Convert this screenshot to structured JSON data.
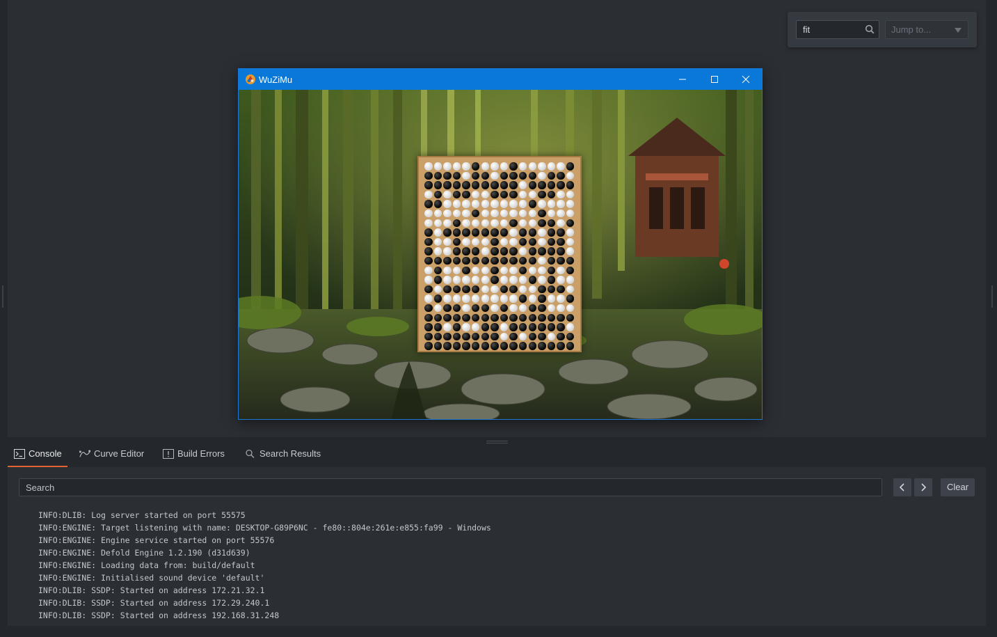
{
  "toolbar": {
    "find_value": "fit",
    "jump_placeholder": "Jump to..."
  },
  "game_window": {
    "title": "WuZiMu"
  },
  "board": {
    "rows": [
      "WWWWWBWWWBWWWWWB",
      "BBBBWBBWBBBBWBBW",
      "BBBBBBBBBBWBBBBB",
      "WBWBBWWBBBWWBBWW",
      "BBWWWWWWWWWBWWWW",
      "WWWWWBWWWWWWBWWW",
      "WWWBWWWWWBWWBBWB",
      "BWBBBBBBBWBBWBBW",
      "BWWBWWWBWWBBWBBW",
      "BWWBBBWBBBWBBBBW",
      "BBBBBBBBBBBBWBBB",
      "WBWWBWWBWWBWWBWB",
      "WBWWWWWBWWWBWBWW",
      "BWBBBBWWBBWWBBBW",
      "WBWWWWWWWWBWBWWB",
      "BWBBWBBWBWWBBWWW",
      "BBBBBBBBBBBBBBBB",
      "BBWBWWBBWBBBBBBW",
      "BBBBBBBBWBWBBWBB",
      "BBBBBBBBBBBBBBBB"
    ]
  },
  "bottom_panel": {
    "tabs": [
      {
        "label": "Console"
      },
      {
        "label": "Curve Editor"
      },
      {
        "label": "Build Errors"
      },
      {
        "label": "Search Results"
      }
    ],
    "search_placeholder": "Search",
    "clear_label": "Clear",
    "log_lines": [
      "INFO:DLIB: Log server started on port 55575",
      "INFO:ENGINE: Target listening with name: DESKTOP-G89P6NC - fe80::804e:261e:e855:fa99 - Windows",
      "INFO:ENGINE: Engine service started on port 55576",
      "INFO:ENGINE: Defold Engine 1.2.190 (d31d639)",
      "INFO:ENGINE: Loading data from: build/default",
      "INFO:ENGINE: Initialised sound device 'default'",
      "INFO:DLIB: SSDP: Started on address 172.21.32.1",
      "INFO:DLIB: SSDP: Started on address 172.29.240.1",
      "INFO:DLIB: SSDP: Started on address 192.168.31.248"
    ]
  },
  "colors": {
    "accent": "#0a78d8",
    "active_tab": "#e2632f",
    "panel_bg": "#2b2e33"
  }
}
